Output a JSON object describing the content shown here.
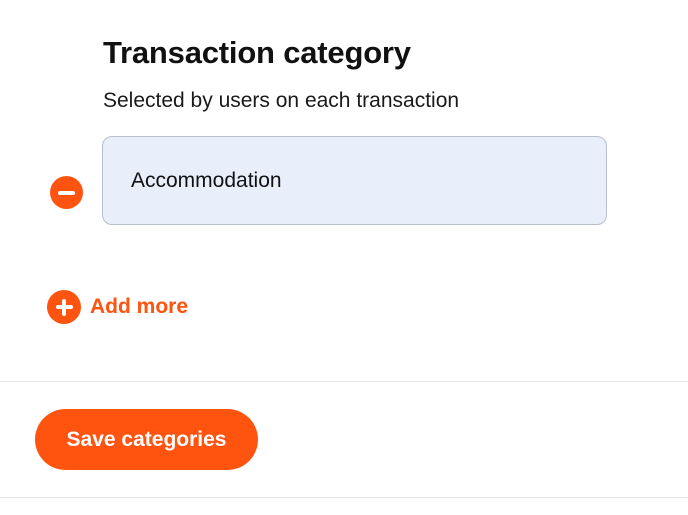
{
  "section": {
    "title": "Transaction category",
    "subtitle": "Selected by users on each transaction"
  },
  "categories": [
    {
      "value": "Accommodation"
    }
  ],
  "add_more_label": "Add more",
  "save_button_label": "Save categories",
  "icons": {
    "remove": "minus-circle-icon",
    "add": "plus-circle-icon"
  },
  "colors": {
    "accent": "#ff5310",
    "input_background": "#e8effb",
    "input_border": "#b9c0cc"
  }
}
